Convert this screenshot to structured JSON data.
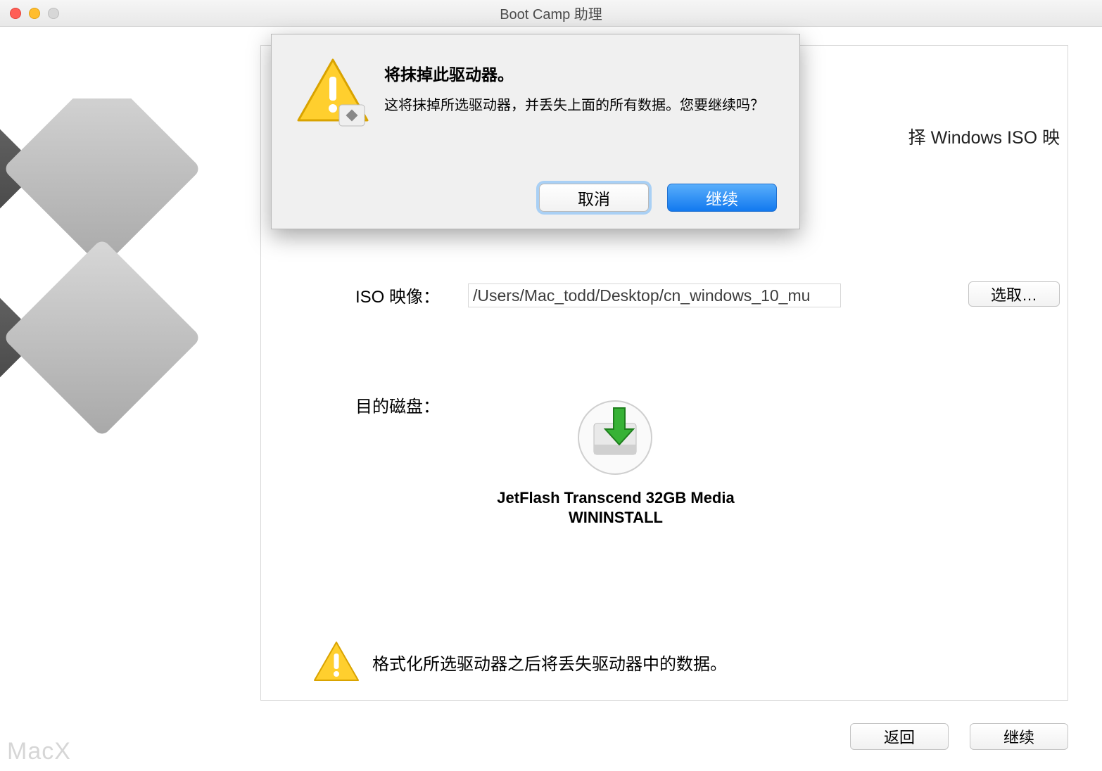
{
  "window": {
    "title": "Boot Camp 助理"
  },
  "side_text": "择 Windows ISO 映",
  "iso": {
    "label": "ISO 映像：",
    "path": "/Users/Mac_todd/Desktop/cn_windows_10_mu",
    "choose": "选取…"
  },
  "disk": {
    "label": "目的磁盘：",
    "name_line1": "JetFlash Transcend 32GB Media",
    "name_line2": "WININSTALL"
  },
  "warning_footer": "格式化所选驱动器之后将丢失驱动器中的数据。",
  "footer": {
    "back": "返回",
    "continue": "继续"
  },
  "modal": {
    "title": "将抹掉此驱动器。",
    "message": "这将抹掉所选驱动器，并丢失上面的所有数据。您要继续吗？",
    "cancel": "取消",
    "continue": "继续"
  },
  "watermark": "MacX"
}
